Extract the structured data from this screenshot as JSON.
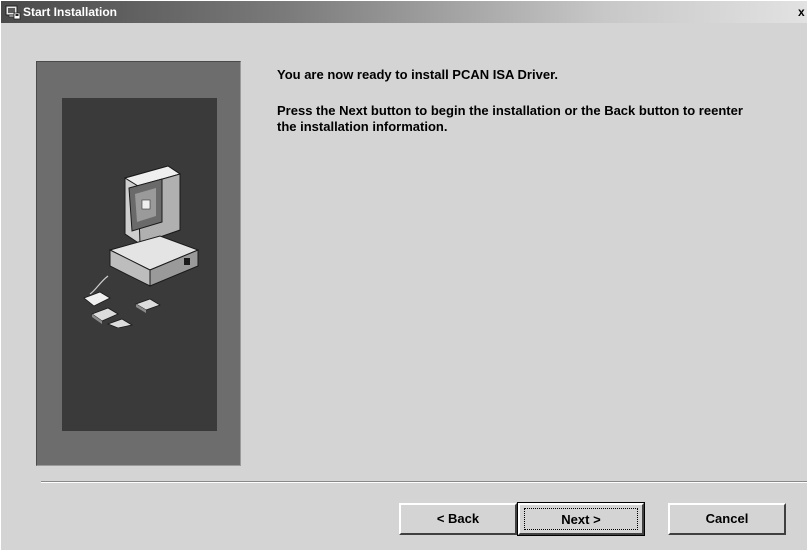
{
  "window": {
    "title": "Start Installation",
    "close_glyph": "x",
    "title_icon": "installer-icon"
  },
  "content": {
    "heading": "You are now ready to install PCAN ISA Driver.",
    "body": "Press the Next button to begin the installation or the Back button to reenter the installation information."
  },
  "illustration": {
    "icon": "computer-with-disks-illustration"
  },
  "buttons": {
    "back": "< Back",
    "next": "Next >",
    "cancel": "Cancel"
  },
  "colors": {
    "dialog_bg": "#d4d4d4",
    "panel_outer": "#6d6d6d",
    "panel_inner": "#3a3a3a"
  }
}
